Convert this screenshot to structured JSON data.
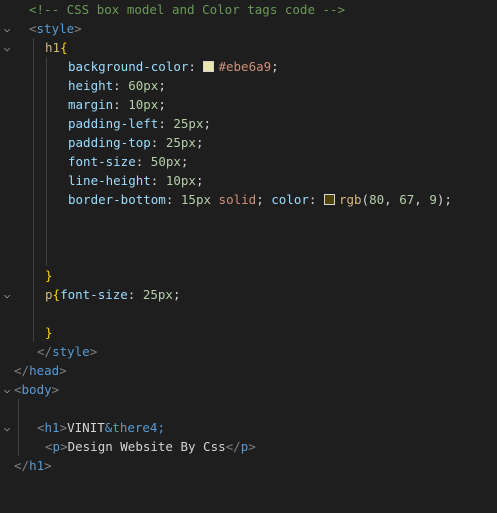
{
  "gutter_icon": "chevron-down-icon",
  "colors": {
    "swatch_bg": "#ebe6a9",
    "swatch_rgb": "#504309"
  },
  "lines": {
    "l1": {
      "comment": "<!-- CSS box model and Color tags code -->"
    },
    "l2": {
      "open": "<",
      "tag": "style",
      "close": ">"
    },
    "l3": {
      "selector": "h1",
      "brace": "{"
    },
    "l4": {
      "prop": "background-color",
      "colon": ":",
      "value": "#ebe6a9",
      "semi": ";"
    },
    "l5": {
      "prop": "height",
      "colon": ":",
      "value": "60px",
      "semi": ";"
    },
    "l6": {
      "prop": "margin",
      "colon": ":",
      "value": "10px",
      "semi": ";"
    },
    "l7": {
      "prop": "padding-left",
      "colon": ":",
      "value": "25px",
      "semi": ";"
    },
    "l8": {
      "prop": "padding-top",
      "colon": ":",
      "value": "25px",
      "semi": ";"
    },
    "l9": {
      "prop": "font-size",
      "colon": ":",
      "value": "50px",
      "semi": ";"
    },
    "l10": {
      "prop": "line-height",
      "colon": ":",
      "value": "10px",
      "semi": ";"
    },
    "l11": {
      "prop": "border-bottom",
      "colon": ":",
      "num": "15px",
      "kw": "solid",
      "semi": ";",
      "prop2": "color",
      "colon2": ":",
      "fn": "rgb",
      "paren_open": "(",
      "n1": "80",
      "comma1": ",",
      "n2": "67",
      "comma2": ",",
      "n3": "9",
      "paren_close": ")",
      "semi2": ";"
    },
    "l14": {
      "brace": "}"
    },
    "l15": {
      "selector": "p",
      "brace": "{",
      "prop": "font-size",
      "colon": ":",
      "value": "25px",
      "semi": ";"
    },
    "l17": {
      "brace": "}"
    },
    "l18": {
      "open": "</",
      "tag": "style",
      "close": ">"
    },
    "l19": {
      "open": "</",
      "tag": "head",
      "close": ">"
    },
    "l20": {
      "open": "<",
      "tag": "body",
      "close": ">"
    },
    "l22": {
      "open": "<",
      "tag": "h1",
      "close": ">",
      "text": "VINIT",
      "entity": "&there4;"
    },
    "l23": {
      "open": "<",
      "tag": "p",
      "close": ">",
      "text": "Design Website By Css",
      "end_open": "</",
      "end_tag": "p",
      "end_close": ">"
    },
    "l24": {
      "open": "</",
      "tag": "h1",
      "close": ">"
    }
  }
}
